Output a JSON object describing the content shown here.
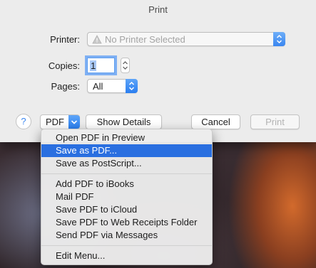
{
  "window": {
    "title": "Print"
  },
  "printer": {
    "label": "Printer:",
    "value": "No Printer Selected",
    "warning_icon": "warning-triangle-icon"
  },
  "copies": {
    "label": "Copies:",
    "value": "1"
  },
  "pages": {
    "label": "Pages:",
    "value": "All"
  },
  "buttons": {
    "help": "?",
    "pdf": "PDF",
    "show_details": "Show Details",
    "cancel": "Cancel",
    "print": "Print"
  },
  "pdf_menu": {
    "group1": [
      "Open PDF in Preview",
      "Save as PDF...",
      "Save as PostScript..."
    ],
    "group2": [
      "Add PDF to iBooks",
      "Mail PDF",
      "Save PDF to iCloud",
      "Save PDF to Web Receipts Folder",
      "Send PDF via Messages"
    ],
    "group3": [
      "Edit Menu..."
    ],
    "selected": "Save as PDF..."
  },
  "colors": {
    "accent": "#2a7ef0",
    "menu_highlight": "#2a6fe0"
  }
}
